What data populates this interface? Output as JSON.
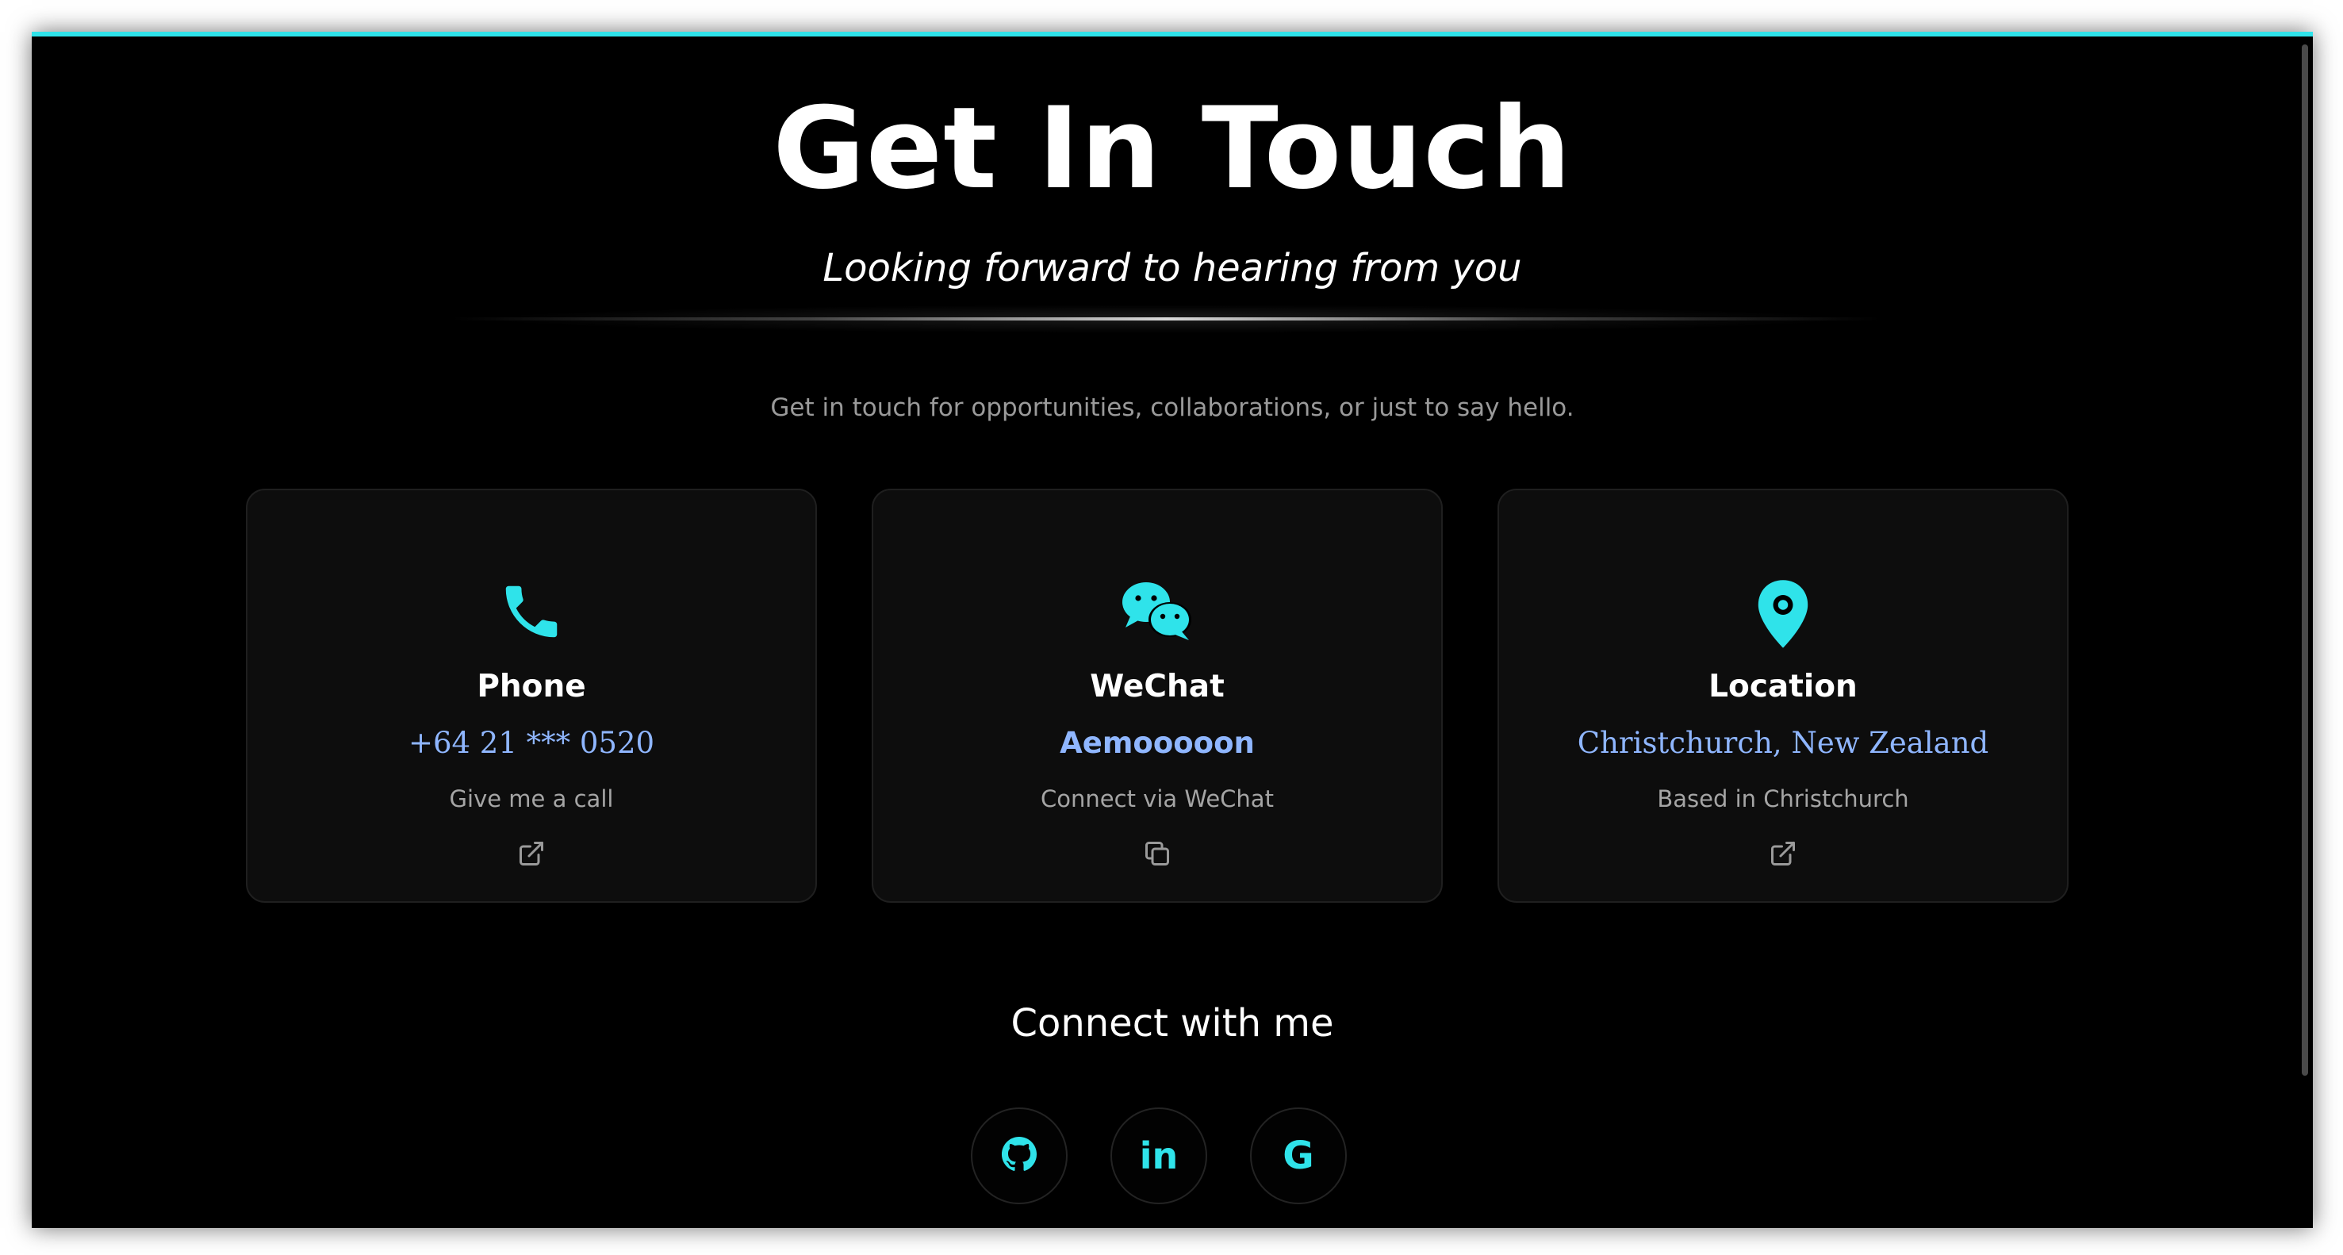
{
  "header": {
    "title": "Get In Touch",
    "subtitle": "Looking forward to hearing from you",
    "intro": "Get in touch for opportunities, collaborations, or just to say hello."
  },
  "cards": [
    {
      "icon": "phone-icon",
      "title": "Phone",
      "value": "+64 21 *** 0520",
      "description": "Give me a call",
      "action_icon": "external-link-icon"
    },
    {
      "icon": "wechat-icon",
      "title": "WeChat",
      "value": "Aemooooon",
      "description": "Connect via WeChat",
      "action_icon": "copy-icon"
    },
    {
      "icon": "location-pin-icon",
      "title": "Location",
      "value": "Christchurch, New Zealand",
      "description": "Based in Christchurch",
      "action_icon": "external-link-icon"
    }
  ],
  "connect": {
    "title": "Connect with me",
    "links": [
      {
        "icon": "github-icon"
      },
      {
        "icon": "linkedin-icon",
        "glyph": "in"
      },
      {
        "icon": "google-icon",
        "glyph": "G"
      }
    ]
  },
  "colors": {
    "accent": "#2fe3ea",
    "value_text": "#8fb6ff",
    "background": "#000000",
    "card_background": "#0d0d0d"
  }
}
